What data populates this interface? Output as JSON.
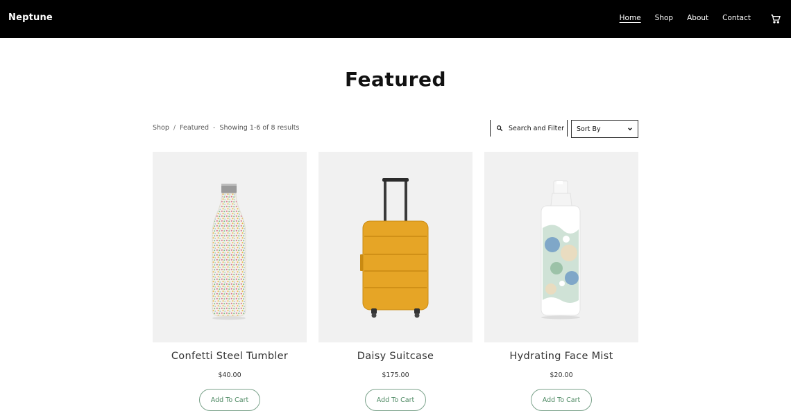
{
  "header": {
    "brand": "Neptune",
    "nav": [
      "Home",
      "Shop",
      "About",
      "Contact"
    ],
    "active_nav": "Home",
    "cart_icon": "cart-icon"
  },
  "main": {
    "title": "Featured",
    "breadcrumb": [
      "Shop",
      "Featured"
    ],
    "results_text": "Showing 1-6 of 8 results",
    "search_filter_label": "Search and Filter",
    "sort_label": "Sort By"
  },
  "products": [
    {
      "name": "Confetti Steel Tumbler",
      "price": "$40.00",
      "cta": "Add To Cart"
    },
    {
      "name": "Daisy Suitcase",
      "price": "$175.00",
      "cta": "Add To Cart"
    },
    {
      "name": "Hydrating Face Mist",
      "price": "$20.00",
      "cta": "Add To Cart"
    }
  ],
  "colors": {
    "header_bg": "#000000",
    "card_bg": "#f1f1f1",
    "button_border": "#7aa28a",
    "button_text": "#4f8a64",
    "suitcase": "#e6a526"
  }
}
